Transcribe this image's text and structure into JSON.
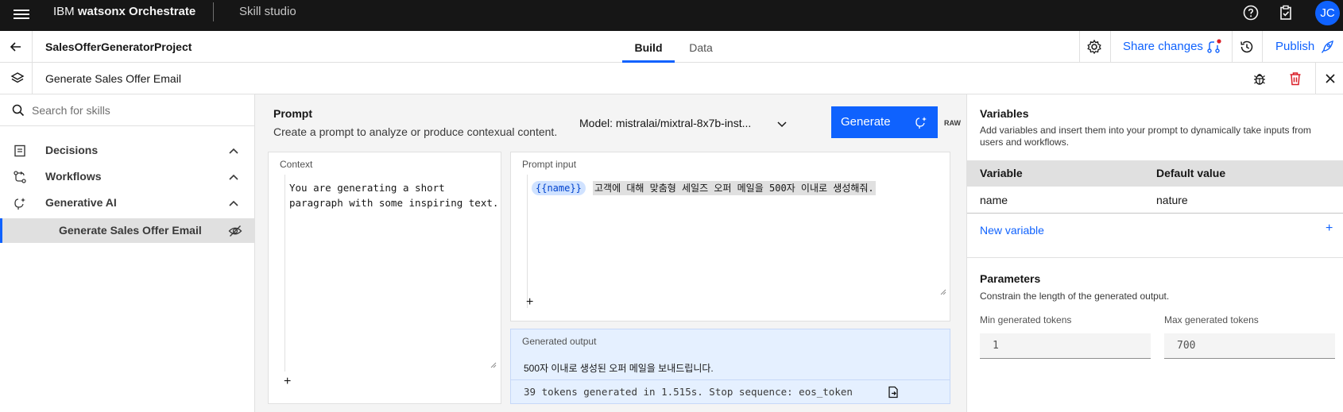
{
  "header": {
    "brand_prefix": "IBM ",
    "brand_name": "watsonx Orchestrate",
    "app_name": "Skill studio",
    "avatar_initials": "JC",
    "icons": [
      "menu-icon",
      "help-icon",
      "clipboard-icon"
    ]
  },
  "project_bar": {
    "project_name": "SalesOfferGeneratorProject",
    "tabs": [
      {
        "label": "Build",
        "active": true
      },
      {
        "label": "Data",
        "active": false
      }
    ],
    "share_label": "Share changes",
    "publish_label": "Publish"
  },
  "skill_bar": {
    "skill_name": "Generate Sales Offer Email"
  },
  "sidebar": {
    "search_placeholder": "Search for skills",
    "sections": [
      {
        "label": "Decisions",
        "icon": "document-icon"
      },
      {
        "label": "Workflows",
        "icon": "flow-icon"
      },
      {
        "label": "Generative AI",
        "icon": "ai-spark-icon"
      }
    ],
    "selected_item": "Generate Sales Offer Email"
  },
  "prompt": {
    "title": "Prompt",
    "description": "Create a prompt to analyze or produce contexual content.",
    "model_label": "Model: mistralai/mixtral-8x7b-inst...",
    "generate_label": "Generate",
    "raw_label": "RAW",
    "context_label": "Context",
    "context_text": "You are generating a short paragraph with some inspiring text.",
    "input_label": "Prompt input",
    "variable_chip": "{{name}}",
    "input_text": "고객에 대해 맞춤형 세일즈 오퍼 메일을 500자 이내로 생성해줘.",
    "output_label": "Generated output",
    "output_text": "500자 이내로 생성된 오퍼 메일을 보내드립니다.",
    "output_stats": "39 tokens generated in 1.515s. Stop sequence: eos_token"
  },
  "variables": {
    "title": "Variables",
    "description": "Add variables and insert them into your prompt to dynamically take inputs from users and workflows.",
    "columns": [
      "Variable",
      "Default value"
    ],
    "rows": [
      {
        "variable": "name",
        "default": "nature"
      }
    ],
    "new_label": "New variable"
  },
  "parameters": {
    "title": "Parameters",
    "description": "Constrain the length of the generated output.",
    "min_label": "Min generated tokens",
    "min_value": "1",
    "max_label": "Max generated tokens",
    "max_value": "700"
  },
  "colors": {
    "accent": "#0f62fe",
    "danger": "#da1e28",
    "header_bg": "#161616"
  }
}
